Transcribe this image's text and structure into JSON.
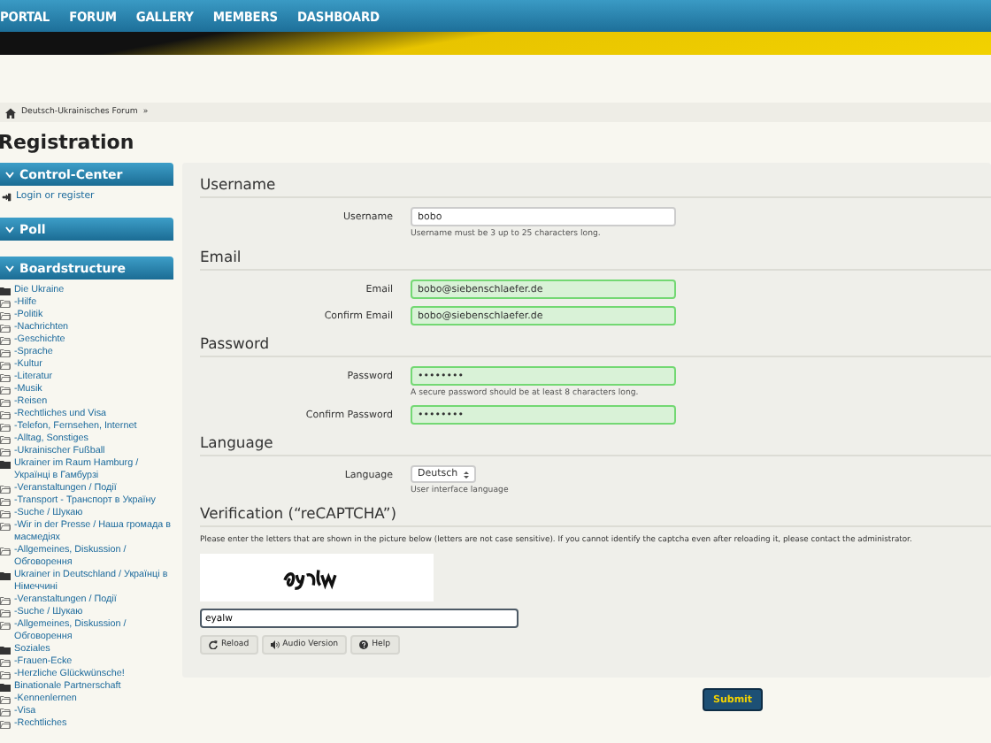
{
  "nav": {
    "items": [
      "PORTAL",
      "FORUM",
      "GALLERY",
      "MEMBERS",
      "DASHBOARD"
    ]
  },
  "breadcrumb": {
    "items": [
      {
        "label": "Deutsch-Ukrainisches Forum",
        "separator": "»"
      }
    ]
  },
  "page_title": "Registration",
  "sidebar": {
    "boxes": [
      {
        "title": "Control-Center",
        "links": [
          {
            "label": "Login or register"
          }
        ]
      },
      {
        "title": "Poll"
      },
      {
        "title": "Boardstructure",
        "tree": [
          {
            "label": "Die Ukraine",
            "children": [
              {
                "label": "-Hilfe"
              },
              {
                "label": "-Politik"
              },
              {
                "label": "-Nachrichten"
              },
              {
                "label": "-Geschichte"
              },
              {
                "label": "-Sprache"
              },
              {
                "label": "-Kultur"
              },
              {
                "label": "-Literatur"
              },
              {
                "label": "-Musik"
              },
              {
                "label": "-Reisen"
              },
              {
                "label": "-Rechtliches und Visa"
              },
              {
                "label": "-Telefon, Fernsehen, Internet"
              },
              {
                "label": "-Alltag, Sonstiges"
              },
              {
                "label": "-Ukrainischer Fußball"
              }
            ]
          },
          {
            "label": "Ukrainer im Raum Hamburg / Українці в Гамбурзі",
            "children": [
              {
                "label": "-Veranstaltungen / Події"
              },
              {
                "label": "-Transport - Транспорт в Україну"
              },
              {
                "label": "-Suche / Шукаю"
              },
              {
                "label": "-Wir in der Presse / Наша громада в масмедіях"
              },
              {
                "label": "-Allgemeines, Diskussion / Обговорення"
              }
            ]
          },
          {
            "label": "Ukrainer in Deutschland / Українці в Німеччині",
            "children": [
              {
                "label": "-Veranstaltungen / Події"
              },
              {
                "label": "-Suche / Шукаю"
              },
              {
                "label": "-Allgemeines, Diskussion / Обговорення"
              }
            ]
          },
          {
            "label": "Soziales",
            "children": [
              {
                "label": "-Frauen-Ecke"
              },
              {
                "label": "-Herzliche Glückwünsche!"
              }
            ]
          },
          {
            "label": "Binationale Partnerschaft",
            "children": [
              {
                "label": "-Kennenlernen"
              },
              {
                "label": "-Visa"
              },
              {
                "label": "-Rechtliches"
              }
            ]
          }
        ]
      }
    ]
  },
  "form": {
    "sections": [
      {
        "title": "Username",
        "fields": [
          {
            "kind": "text",
            "label": "Username",
            "value": "bobo",
            "valid": false,
            "hint": "Username must be 3 up to 25 characters long."
          }
        ]
      },
      {
        "title": "Email",
        "fields": [
          {
            "kind": "text",
            "label": "Email",
            "value": "bobo@siebenschlaefer.de",
            "valid": true
          },
          {
            "kind": "text",
            "label": "Confirm Email",
            "value": "bobo@siebenschlaefer.de",
            "valid": true
          }
        ]
      },
      {
        "title": "Password",
        "fields": [
          {
            "kind": "text",
            "label": "Password",
            "value": "••••••••",
            "valid": true,
            "hint": "A secure password should be at least 8 characters long."
          },
          {
            "kind": "text",
            "label": "Confirm Password",
            "value": "••••••••",
            "valid": true
          }
        ]
      },
      {
        "title": "Language",
        "fields": [
          {
            "kind": "select",
            "label": "Language",
            "value": "Deutsch",
            "hint": "User interface language"
          }
        ]
      }
    ],
    "verification": {
      "title": "Verification (“reCAPTCHA”)",
      "instructions": "Please enter the letters that are shown in the picture below (letters are not case sensitive). If you cannot identify the captcha even after reloading it, please contact the administrator.",
      "answer": "eyalw",
      "buttons": [
        {
          "kind": "reload",
          "label": "Reload"
        },
        {
          "kind": "audio",
          "label": "Audio Version"
        },
        {
          "kind": "help",
          "label": "Help"
        }
      ]
    },
    "submit": "Submit"
  }
}
